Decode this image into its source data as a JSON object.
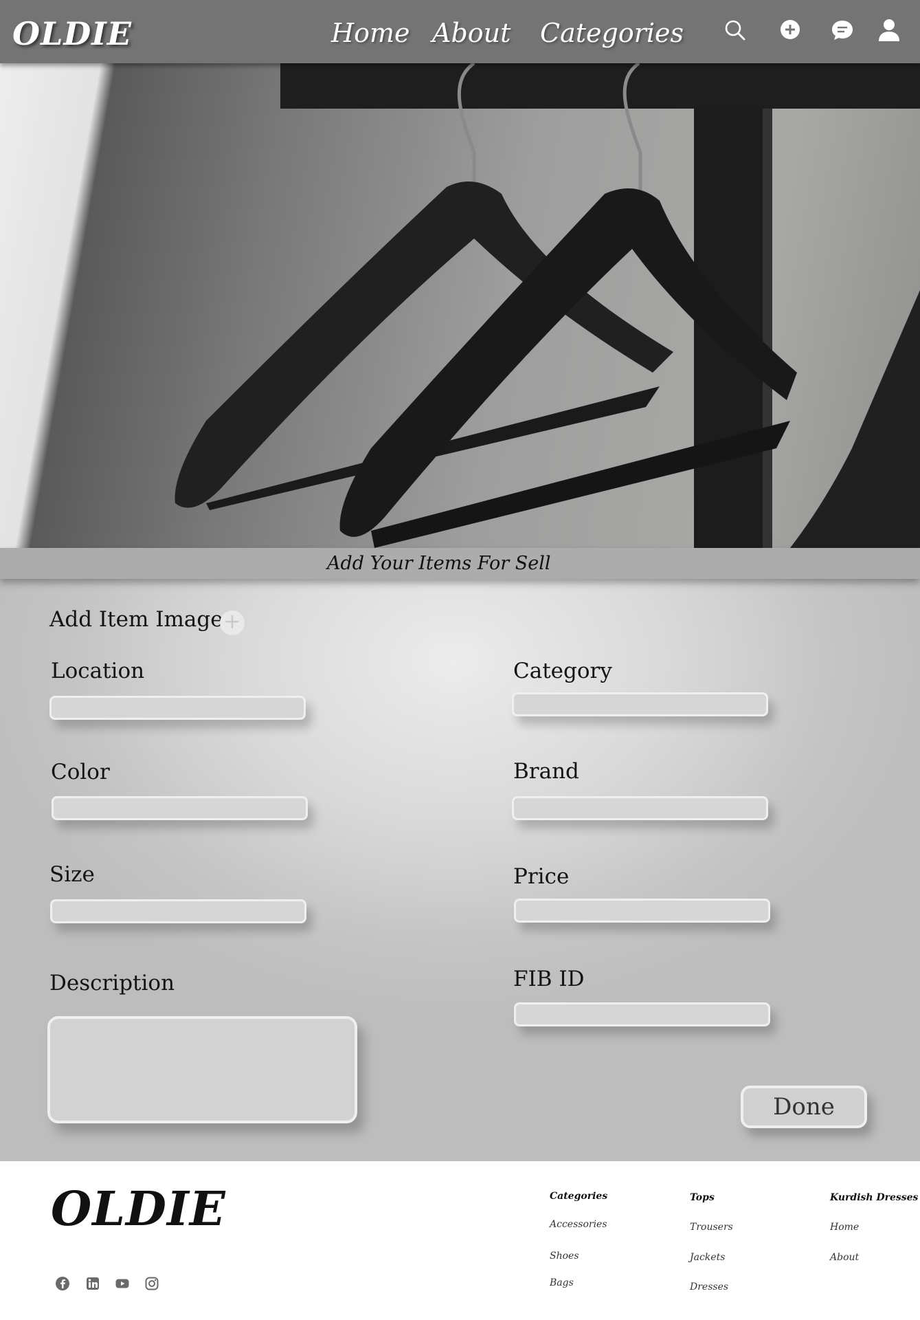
{
  "header": {
    "brand": "OLDIE",
    "nav": [
      "Home",
      "About",
      "Categories"
    ],
    "icons": [
      "search-icon",
      "add-circle-icon",
      "chat-icon",
      "user-icon"
    ]
  },
  "hero": {
    "subtitle": "Add Your Items For Sell"
  },
  "form": {
    "add_image_label": "Add Item Image",
    "add_image_icon": "plus-icon",
    "fields": {
      "location": "Location",
      "category": "Category",
      "color": "Color",
      "brand": "Brand",
      "size": "Size",
      "price": "Price",
      "description": "Description",
      "fib_id": "FIB ID"
    },
    "done_label": "Done"
  },
  "footer": {
    "brand": "OLDIE",
    "col1": [
      "Categories",
      "Accessories",
      "Shoes",
      "Bags"
    ],
    "col2": [
      "Tops",
      "Trousers",
      "Jackets",
      "Dresses"
    ],
    "col3": [
      "Kurdish Dresses",
      "Home",
      "About"
    ],
    "social_icons": [
      "facebook-icon",
      "linkedin-icon",
      "youtube-icon",
      "instagram-icon"
    ]
  },
  "colors": {
    "header_bg": "#747474",
    "subtitle_bar": "#acacac",
    "form_bg": "#d9d9d9",
    "footer_bg": "#ffffff"
  }
}
